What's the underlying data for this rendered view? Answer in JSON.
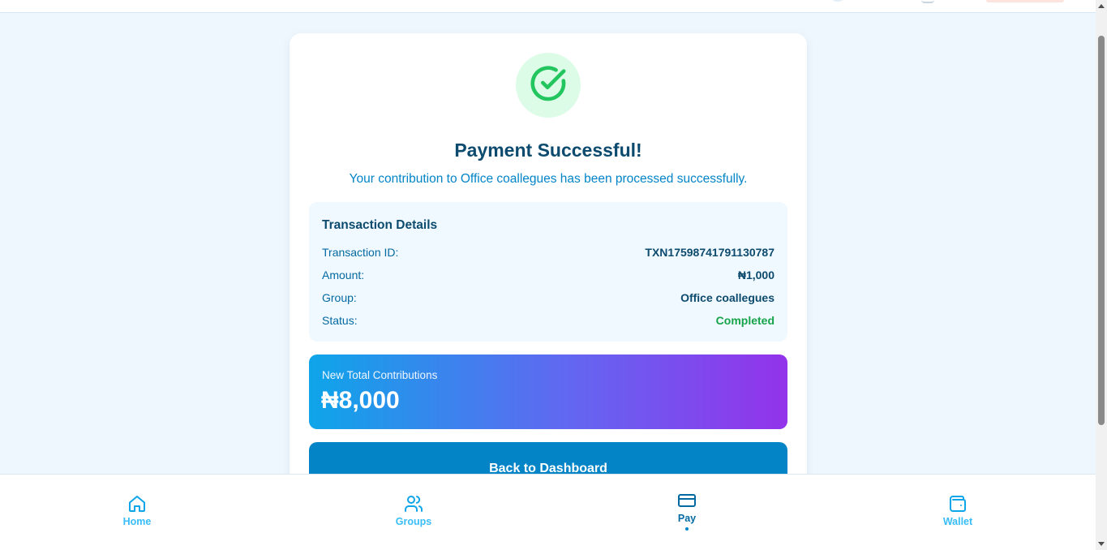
{
  "success": {
    "title": "Payment Successful!",
    "message": "Your contribution to Office coallegues has been processed successfully.",
    "icon": "check-circle-icon",
    "icon_color": "#22c55e"
  },
  "details": {
    "heading": "Transaction Details",
    "rows": [
      {
        "label": "Transaction ID:",
        "value": "TXN17598741791130787"
      },
      {
        "label": "Amount:",
        "value": "₦1,000"
      },
      {
        "label": "Group:",
        "value": "Office coallegues"
      },
      {
        "label": "Status:",
        "value": "Completed"
      }
    ],
    "status_color": "#16a34a"
  },
  "total": {
    "label": "New Total Contributions",
    "amount": "₦8,000"
  },
  "actions": {
    "back_label": "Back to Dashboard"
  },
  "nav": {
    "items": [
      {
        "label": "Home",
        "icon": "home-icon",
        "active": false
      },
      {
        "label": "Groups",
        "icon": "users-icon",
        "active": false
      },
      {
        "label": "Pay",
        "icon": "credit-card-icon",
        "active": true
      },
      {
        "label": "Wallet",
        "icon": "wallet-icon",
        "active": false
      }
    ]
  },
  "colors": {
    "background": "#eff7fe",
    "primary": "#0284c7",
    "heading": "#0c4a6e",
    "gradient_start": "#0ea5e9",
    "gradient_end": "#9333ea"
  }
}
